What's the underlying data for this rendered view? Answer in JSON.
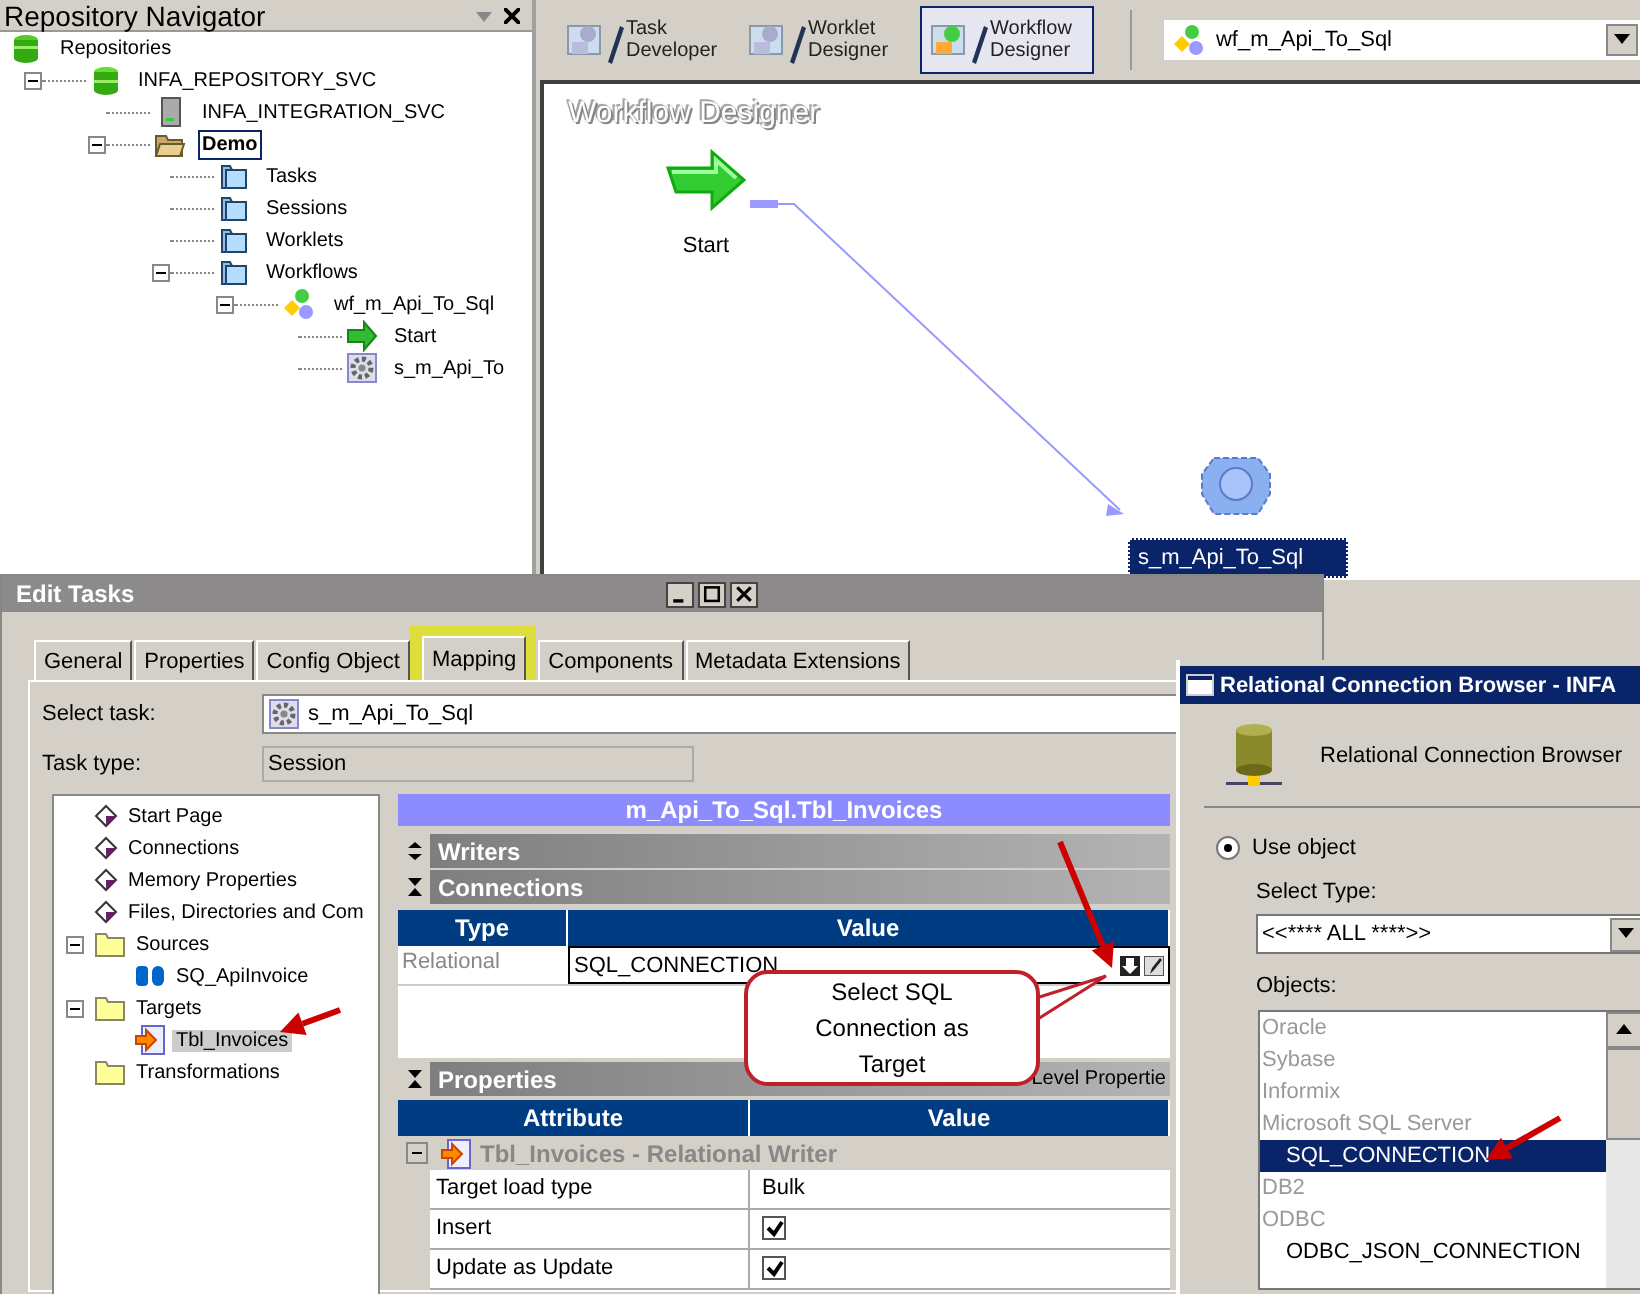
{
  "navigator": {
    "title": "Repository Navigator",
    "tree": [
      {
        "label": "Repositories",
        "kind": "repositories",
        "selected": false,
        "children": [
          {
            "label": "INFA_REPOSITORY_SVC",
            "kind": "repository",
            "selected": false,
            "children": [
              {
                "label": "INFA_INTEGRATION_SVC",
                "kind": "server",
                "selected": false
              },
              {
                "label": "Demo",
                "kind": "open-folder",
                "selected": true,
                "children": [
                  {
                    "label": "Tasks",
                    "kind": "folder",
                    "selected": false
                  },
                  {
                    "label": "Sessions",
                    "kind": "folder",
                    "selected": false
                  },
                  {
                    "label": "Worklets",
                    "kind": "folder",
                    "selected": false
                  },
                  {
                    "label": "Workflows",
                    "kind": "folder",
                    "selected": false,
                    "children": [
                      {
                        "label": "wf_m_Api_To_Sql",
                        "kind": "workflow",
                        "selected": false,
                        "children": [
                          {
                            "label": "Start",
                            "kind": "start",
                            "selected": false
                          },
                          {
                            "label": "s_m_Api_To",
                            "kind": "session",
                            "selected": false
                          }
                        ]
                      }
                    ]
                  }
                ]
              }
            ]
          }
        ]
      }
    ]
  },
  "designer": {
    "tools": [
      {
        "label": "Task Developer",
        "selected": false
      },
      {
        "label": "Worklet Designer",
        "selected": false
      },
      {
        "label": "Workflow Designer",
        "selected": true
      }
    ],
    "workflow_select": {
      "value": "wf_m_Api_To_Sql"
    },
    "canvas": {
      "title": "Workflow Designer",
      "nodes": [
        {
          "label": "Start",
          "kind": "start",
          "selected": false
        },
        {
          "label": "s_m_Api_To_Sql",
          "kind": "session",
          "selected": true
        }
      ]
    }
  },
  "edit_tasks": {
    "title": "Edit Tasks",
    "tabs": [
      {
        "label": "General",
        "selected": false,
        "highlighted": false
      },
      {
        "label": "Properties",
        "selected": false,
        "highlighted": false
      },
      {
        "label": "Config Object",
        "selected": false,
        "highlighted": false
      },
      {
        "label": "Mapping",
        "selected": true,
        "highlighted": true
      },
      {
        "label": "Components",
        "selected": false,
        "highlighted": false
      },
      {
        "label": "Metadata Extensions",
        "selected": false,
        "highlighted": false
      }
    ],
    "select_task": {
      "label": "Select task:",
      "value": "s_m_Api_To_Sql"
    },
    "task_type": {
      "label": "Task type:",
      "value": "Session"
    },
    "tree": [
      {
        "label": "Start Page",
        "kind": "property",
        "selected": false
      },
      {
        "label": "Connections",
        "kind": "property",
        "selected": false
      },
      {
        "label": "Memory Properties",
        "kind": "property",
        "selected": false
      },
      {
        "label": "Files, Directories and Com",
        "kind": "property",
        "selected": false
      },
      {
        "label": "Sources",
        "kind": "group",
        "selected": false,
        "children": [
          {
            "label": "SQ_ApiInvoice",
            "kind": "source",
            "selected": false
          }
        ]
      },
      {
        "label": "Targets",
        "kind": "group",
        "selected": false,
        "children": [
          {
            "label": "Tbl_Invoices",
            "kind": "target",
            "selected": true
          }
        ]
      },
      {
        "label": "Transformations",
        "kind": "group",
        "selected": false
      }
    ],
    "mapping": {
      "header": "m_Api_To_Sql.Tbl_Invoices",
      "writers": {
        "label": "Writers"
      },
      "connections": {
        "label": "Connections",
        "columns": [
          "Type",
          "Value"
        ],
        "rows": [
          {
            "type": "Relational",
            "value": "SQL_CONNECTION"
          }
        ]
      },
      "properties": {
        "label": "Properties",
        "side_label": "Level Propertie",
        "columns": [
          "Attribute",
          "Value"
        ],
        "group": "Tbl_Invoices - Relational Writer",
        "rows": [
          {
            "attribute": "Target load type",
            "kind": "text",
            "value": "Bulk"
          },
          {
            "attribute": "Insert",
            "kind": "checkbox",
            "checked": true
          },
          {
            "attribute": "Update as Update",
            "kind": "checkbox",
            "checked": true
          }
        ]
      }
    }
  },
  "callout": {
    "text": "Select SQL Connection as Target"
  },
  "browser": {
    "title": "Relational Connection Browser - INFA",
    "heading": "Relational Connection Browser",
    "use_object": {
      "label": "Use object",
      "selected": true
    },
    "select_type": {
      "label": "Select Type:",
      "value": "<<**** ALL ****>>"
    },
    "objects": {
      "label": "Objects:",
      "items": [
        {
          "label": "Oracle",
          "kind": "type",
          "selected": false
        },
        {
          "label": "Sybase",
          "kind": "type",
          "selected": false
        },
        {
          "label": "Informix",
          "kind": "type",
          "selected": false
        },
        {
          "label": "Microsoft SQL Server",
          "kind": "type",
          "selected": false
        },
        {
          "label": "SQL_CONNECTION",
          "kind": "connection",
          "selected": true
        },
        {
          "label": "DB2",
          "kind": "type",
          "selected": false
        },
        {
          "label": "ODBC",
          "kind": "type",
          "selected": false
        },
        {
          "label": "ODBC_JSON_CONNECTION",
          "kind": "connection",
          "selected": false
        }
      ]
    }
  }
}
